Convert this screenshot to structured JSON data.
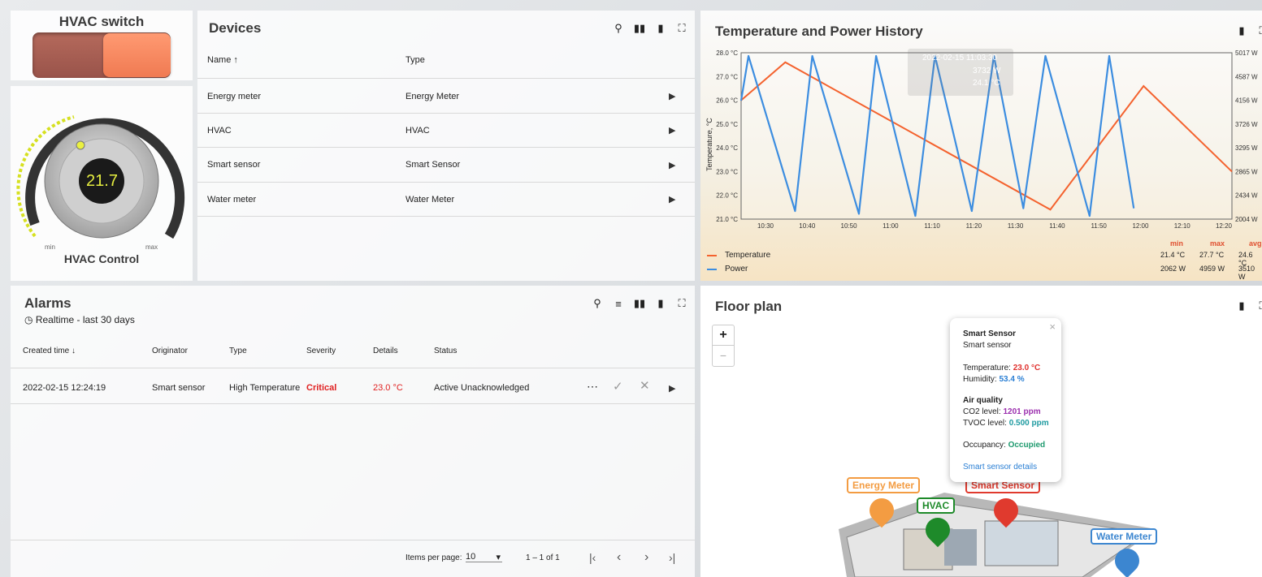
{
  "hvac_switch": {
    "title": "HVAC switch"
  },
  "hvac_control": {
    "title": "HVAC Control",
    "value": "21.7",
    "min_label": "min",
    "max_label": "max"
  },
  "devices": {
    "title": "Devices",
    "columns": [
      "Name ↑",
      "Type"
    ],
    "rows": [
      {
        "name": "Energy meter",
        "type": "Energy Meter"
      },
      {
        "name": "HVAC",
        "type": "HVAC"
      },
      {
        "name": "Smart sensor",
        "type": "Smart Sensor"
      },
      {
        "name": "Water meter",
        "type": "Water Meter"
      }
    ],
    "icons": [
      "search-icon",
      "columns-icon",
      "export-icon",
      "fullscreen-icon"
    ]
  },
  "history": {
    "title": "Temperature and Power History",
    "y_axis_label": "Temperature, °C",
    "legend_headers": [
      "min",
      "max",
      "avg"
    ],
    "legend": [
      {
        "name": "Temperature",
        "color": "#f4622e",
        "min": "21.4 °C",
        "max": "27.7 °C",
        "avg": "24.6 °C"
      },
      {
        "name": "Power",
        "color": "#3c8de0",
        "min": "2062 W",
        "max": "4959 W",
        "avg": "3510 W"
      }
    ],
    "tooltip": {
      "time": "2022-02-15 11:03:30",
      "power": "3732 W",
      "temp": "24.1 °C"
    }
  },
  "chart_data": {
    "type": "line",
    "x_ticks": [
      "10:30",
      "10:40",
      "10:50",
      "11:00",
      "11:10",
      "11:20",
      "11:30",
      "11:40",
      "11:50",
      "12:00",
      "12:10",
      "12:20"
    ],
    "y_ticks_left": [
      "28.0 °C",
      "27.0 °C",
      "26.0 °C",
      "25.0 °C",
      "24.0 °C",
      "23.0 °C",
      "22.0 °C",
      "21.0 °C"
    ],
    "y_ticks_right": [
      "5017 W",
      "4587 W",
      "4156 W",
      "3726 W",
      "3295 W",
      "2865 W",
      "2434 W",
      "2004 W"
    ],
    "ylim_left": [
      21,
      28
    ],
    "ylim_right": [
      2004,
      5017
    ],
    "series": [
      {
        "name": "Temperature",
        "color": "#f4622e",
        "x": [
          0,
          0.09,
          0.63,
          0.82,
          1.0
        ],
        "y": [
          26.0,
          27.6,
          21.4,
          26.6,
          23.0
        ]
      },
      {
        "name": "Power",
        "color": "#3c8de0",
        "x": [
          0,
          0.015,
          0.11,
          0.145,
          0.24,
          0.275,
          0.355,
          0.395,
          0.47,
          0.515,
          0.575,
          0.62,
          0.71,
          0.75,
          0.8
        ],
        "y": [
          4150,
          4959,
          2150,
          4959,
          2100,
          4959,
          2062,
          4959,
          2150,
          4959,
          2200,
          4959,
          2062,
          4959,
          2200
        ]
      }
    ]
  },
  "alarms": {
    "title": "Alarms",
    "subtitle": "Realtime - last 30 days",
    "columns": [
      "Created time ↓",
      "Originator",
      "Type",
      "Severity",
      "Details",
      "Status"
    ],
    "rows": [
      {
        "time": "2022-02-15 12:24:19",
        "originator": "Smart sensor",
        "type": "High Temperature",
        "severity": "Critical",
        "details": "23.0 °C",
        "status": "Active Unacknowledged"
      }
    ],
    "pagination": {
      "label": "Items per page:",
      "size": "10",
      "range": "1 – 1 of 1"
    }
  },
  "floorplan": {
    "title": "Floor plan",
    "zoom_in": "+",
    "zoom_out": "−",
    "popup": {
      "title": "Smart Sensor",
      "subtitle": "Smart sensor",
      "temp_label": "Temperature:",
      "temp_value": "23.0 °C",
      "hum_label": "Humidity:",
      "hum_value": "53.4 %",
      "aq_title": "Air quality",
      "co2_label": "CO2 level:",
      "co2_value": "1201 ppm",
      "tvoc_label": "TVOC level:",
      "tvoc_value": "0.500 ppm",
      "occ_label": "Occupancy:",
      "occ_value": "Occupied",
      "link": "Smart sensor details",
      "close": "×"
    },
    "markers": [
      {
        "label": "Energy Meter",
        "color": "#f39c42"
      },
      {
        "label": "HVAC",
        "color": "#1e8a2a"
      },
      {
        "label": "Smart Sensor",
        "color": "#e03a2e"
      },
      {
        "label": "Water Meter",
        "color": "#3c86d0"
      }
    ]
  }
}
